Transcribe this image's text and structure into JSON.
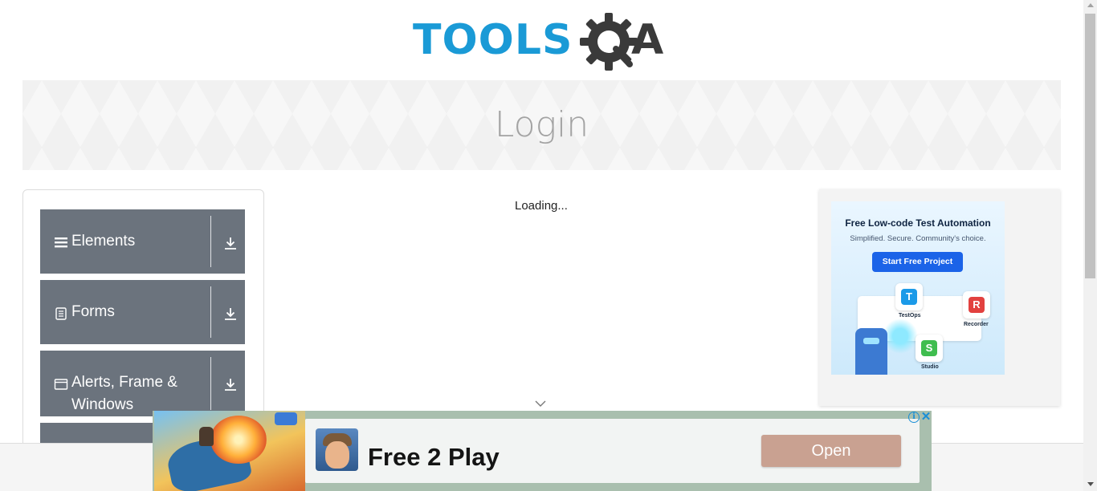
{
  "logo": {
    "text_main": "TOOLS",
    "text_suffix": "A",
    "brand_blue": "#1a9ad6",
    "brand_dark": "#3a3a3a"
  },
  "banner": {
    "title": "Login"
  },
  "sidebar": {
    "groups": [
      {
        "label": "Elements",
        "icon": "hamburger-icon"
      },
      {
        "label": "Forms",
        "icon": "document-icon"
      },
      {
        "label": "Alerts, Frame & Windows",
        "icon": "window-icon"
      }
    ],
    "group_color": "#6b737d"
  },
  "main": {
    "loading_text": "Loading..."
  },
  "ad_right": {
    "headline": "Free Low-code Test Automation",
    "subtitle": "Simplified. Secure. Community's choice.",
    "cta": "Start Free Project",
    "tiles": [
      {
        "letter": "T",
        "name": "TestOps",
        "color": "#1b9ae8"
      },
      {
        "letter": "R",
        "name": "Recorder",
        "color": "#e2413f"
      },
      {
        "letter": "S",
        "name": "Studio",
        "color": "#3fbd4f"
      }
    ]
  },
  "ad_bottom": {
    "title": "Free 2 Play",
    "cta": "Open",
    "info_icon": "info-icon",
    "close_icon": "close-icon"
  }
}
